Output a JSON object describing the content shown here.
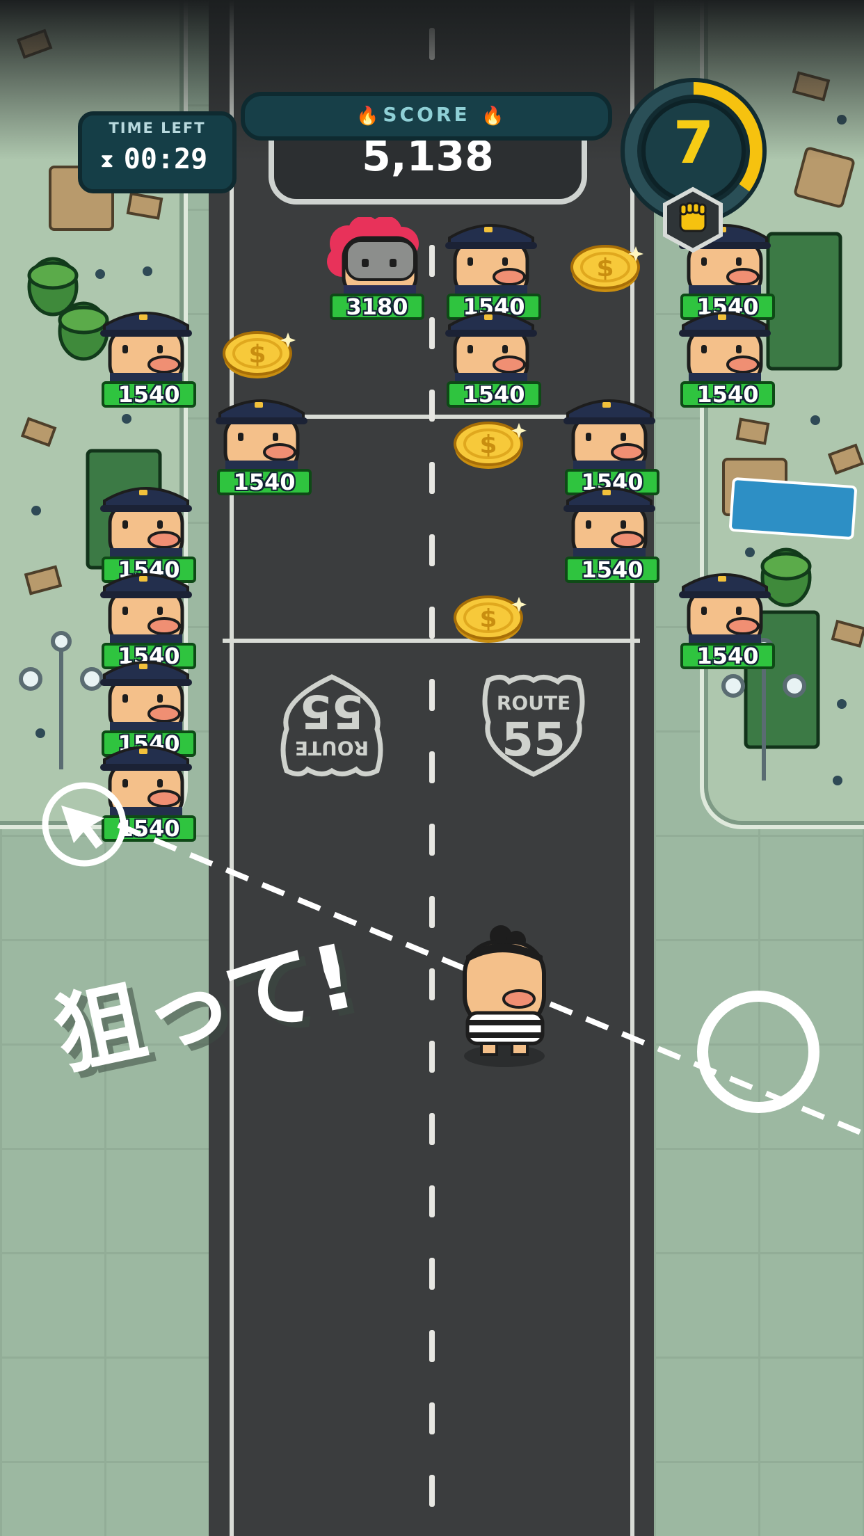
{
  "hud": {
    "time_left_label": "TIME LEFT",
    "time_left_value": "00:29",
    "score_label": "SCORE",
    "score_value": "5,138",
    "level": "7",
    "level_progress": 0.35
  },
  "road": {
    "route_sign_label": "ROUTE",
    "route_sign_number": "55"
  },
  "enemies": [
    {
      "type": "boss-red-hair",
      "hp": "3180"
    },
    {
      "type": "cop",
      "hp": "1540"
    },
    {
      "type": "cop",
      "hp": "1540"
    },
    {
      "type": "cop",
      "hp": "1540"
    },
    {
      "type": "cop",
      "hp": "1540"
    },
    {
      "type": "cop",
      "hp": "1540"
    },
    {
      "type": "cop",
      "hp": "1540"
    },
    {
      "type": "cop",
      "hp": "1540"
    },
    {
      "type": "cop",
      "hp": "1540"
    },
    {
      "type": "cop",
      "hp": "1540"
    },
    {
      "type": "cop",
      "hp": "1540"
    },
    {
      "type": "cop",
      "hp": "1540"
    },
    {
      "type": "cop",
      "hp": "1540"
    },
    {
      "type": "cop",
      "hp": "1540"
    },
    {
      "type": "cop",
      "hp": "1540"
    }
  ],
  "coins_count_visible": 4,
  "hint_text": "狙って!",
  "colors": {
    "hp_bar": "#2fc43f",
    "level_ring": "#f6c20f",
    "hud_panel": "#153e47",
    "road": "#3b3d3e"
  },
  "icons": [
    "hourglass-icon",
    "flame-icon",
    "fist-icon",
    "arrow-cursor-icon",
    "dollar-coin-icon"
  ]
}
